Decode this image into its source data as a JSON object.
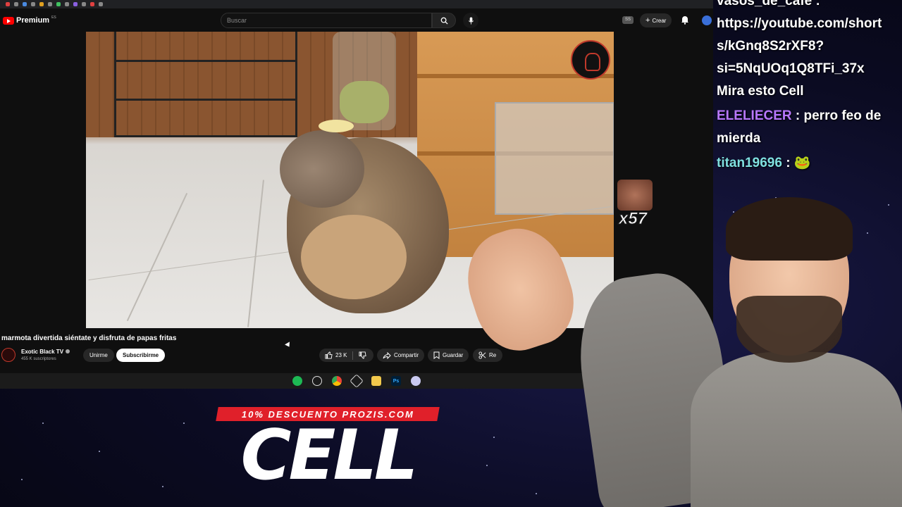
{
  "youtube": {
    "brand": "Premium",
    "country_code": "ES",
    "search_placeholder": "Buscar",
    "cast_badge": "SS",
    "create_label": "Crear"
  },
  "video": {
    "title": "marmota divertida siéntate y disfruta de papas fritas",
    "channel_name": "Exotic Black TV",
    "subscribers": "455 K suscriptores",
    "join_label": "Unirme",
    "subscribe_label": "Subscribirme",
    "like_count": "23 K",
    "share_label": "Compartir",
    "save_label": "Guardar",
    "clip_label": "Re"
  },
  "taskbar": {
    "icons": [
      "spotify-icon",
      "obs-icon",
      "chrome-icon",
      "app-icon",
      "folder-icon",
      "photoshop-icon",
      "discord-icon"
    ],
    "photoshop_text": "Ps"
  },
  "emote": {
    "count": "x57"
  },
  "chat": {
    "lines": [
      {
        "user": "",
        "text": "vasos_de_cafe :"
      },
      {
        "user": "",
        "text": "https://youtube.com/short"
      },
      {
        "user": "",
        "text": "s/kGnq8S2rXF8?"
      },
      {
        "user": "",
        "text": "si=5NqUOq1Q8TFi_37x"
      },
      {
        "user": "",
        "text": "Mira esto Cell"
      }
    ],
    "msg2_user": "ELELIECER",
    "msg2_text_1": " : perro feo de",
    "msg2_text_2": "mierda",
    "msg3_user": "titan19696",
    "msg3_text": " : 🐸"
  },
  "promo": {
    "banner": "10% DESCUENTO PROZIS.COM",
    "logo": "CELL"
  },
  "colors": {
    "yt_red": "#ff0000",
    "promo_red": "#e0202a",
    "chat_purple": "#b878ff",
    "chat_cyan": "#7fe0e0"
  }
}
